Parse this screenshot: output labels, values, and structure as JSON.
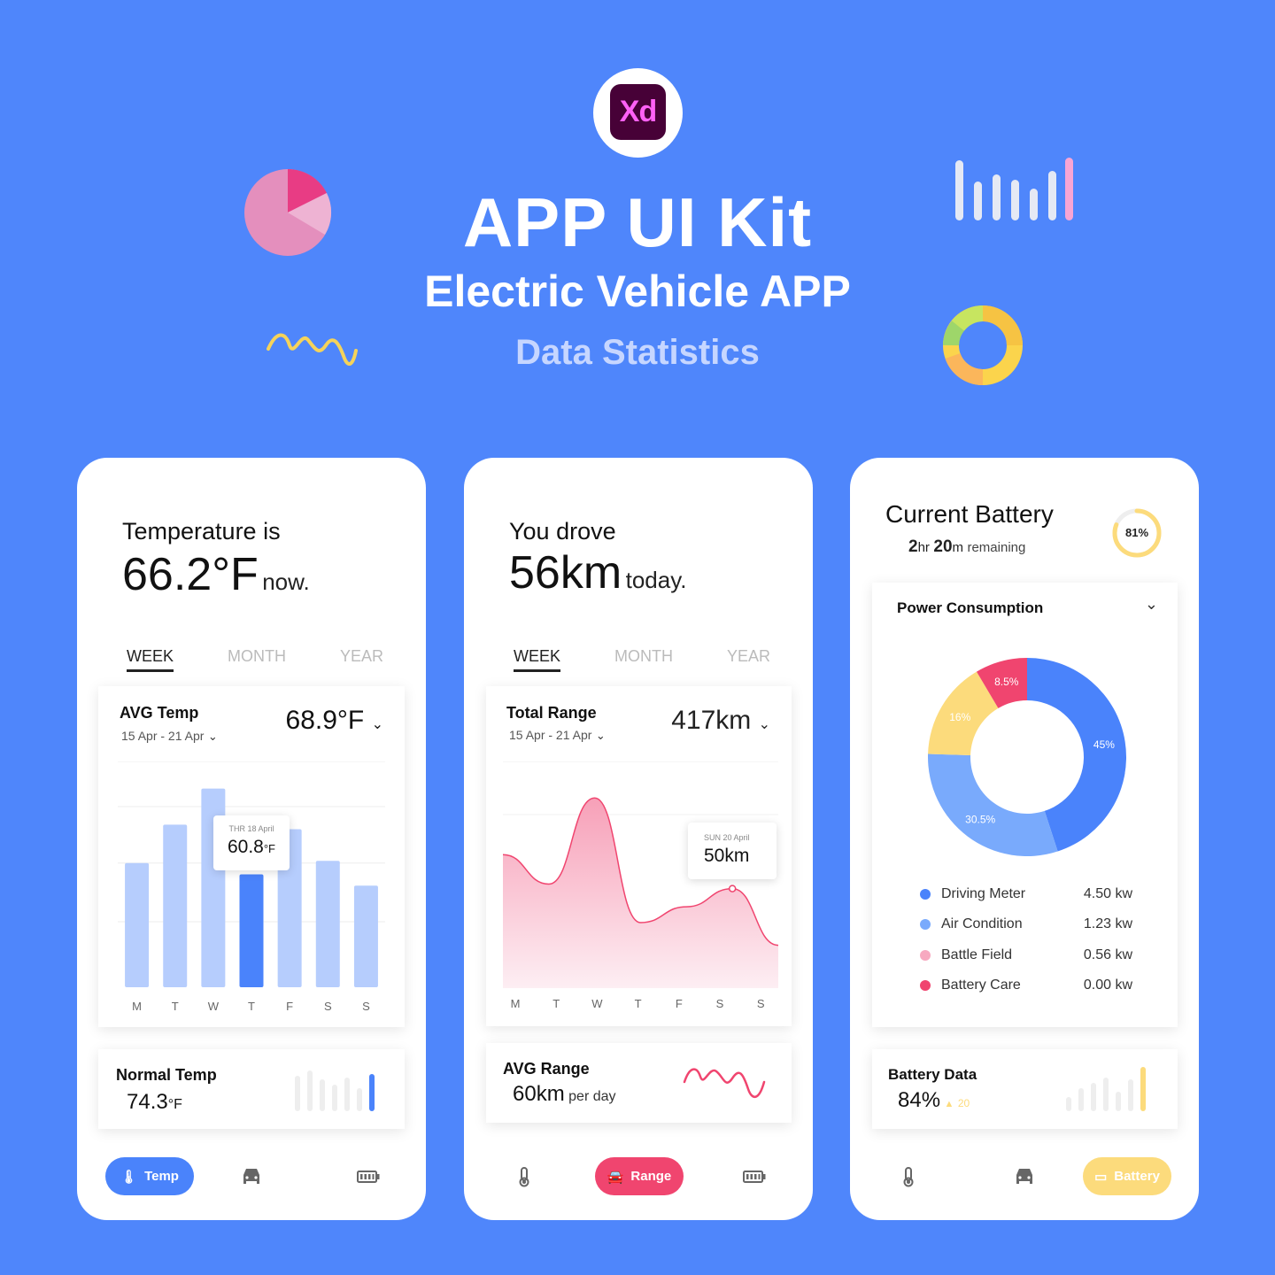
{
  "header": {
    "logo_text": "Xd",
    "title": "APP UI Kit",
    "subtitle": "Electric Vehicle APP",
    "tagline": "Data Statistics"
  },
  "colors": {
    "background": "#4f86fb",
    "blue": "#4a83fb",
    "light_blue": "#b6cdfd",
    "pink": "#f0456f",
    "yellow": "#fcdb7c"
  },
  "temp_screen": {
    "intro": "Temperature is",
    "value": "66.2°F",
    "suffix": "now.",
    "tabs": [
      "WEEK",
      "MONTH",
      "YEAR"
    ],
    "card": {
      "label": "AVG Temp",
      "range": "15 Apr - 21 Apr",
      "value": "68.9°F"
    },
    "tooltip": {
      "date": "THR 18 April",
      "value": "60.8",
      "unit": "°F"
    },
    "chart_data": {
      "type": "bar",
      "categories": [
        "M",
        "T",
        "W",
        "T",
        "F",
        "S",
        "S"
      ],
      "values": [
        55,
        72,
        88,
        50,
        70,
        56,
        45
      ],
      "highlight_index": 3,
      "ylim": [
        0,
        100
      ]
    },
    "normal": {
      "label": "Normal Temp",
      "value": "74.3",
      "unit": "°F"
    },
    "nav": {
      "active_label": "Temp"
    }
  },
  "range_screen": {
    "intro": "You drove",
    "value": "56km",
    "suffix": "today.",
    "tabs": [
      "WEEK",
      "MONTH",
      "YEAR"
    ],
    "card": {
      "label": "Total Range",
      "range": "15 Apr - 21 Apr",
      "value": "417km"
    },
    "tooltip": {
      "date": "SUN 20 April",
      "value": "50km"
    },
    "chart_data": {
      "type": "area",
      "categories": [
        "M",
        "T",
        "W",
        "T",
        "F",
        "S",
        "S"
      ],
      "values": [
        55,
        42,
        80,
        25,
        32,
        40,
        15
      ],
      "ylim": [
        0,
        100
      ]
    },
    "avg": {
      "label": "AVG Range",
      "value": "60km",
      "unit": "per day"
    },
    "nav": {
      "active_label": "Range"
    }
  },
  "battery_screen": {
    "title": "Current Battery",
    "hours": "2",
    "hours_unit": "hr",
    "minutes": "20",
    "minutes_unit": "m",
    "remaining": "remaining",
    "level": "81%",
    "level_value": 81,
    "section_title": "Power Consumption",
    "chart_data": {
      "type": "pie",
      "slices": [
        {
          "label": "45%",
          "value": 45,
          "color": "#4a83fb"
        },
        {
          "label": "30.5%",
          "value": 30.5,
          "color": "#79aafc"
        },
        {
          "label": "16%",
          "value": 16,
          "color": "#fcdb7c"
        },
        {
          "label": "8.5%",
          "value": 8.5,
          "color": "#f0456f"
        }
      ]
    },
    "legend": [
      {
        "name": "Driving Meter",
        "value": "4.50 kw",
        "color": "#4a83fb"
      },
      {
        "name": "Air Condition",
        "value": "1.23 kw",
        "color": "#79aafc"
      },
      {
        "name": "Battle Field",
        "value": "0.56 kw",
        "color": "#f7a9c0"
      },
      {
        "name": "Battery Care",
        "value": "0.00 kw",
        "color": "#f0456f"
      }
    ],
    "data_card": {
      "label": "Battery Data",
      "value": "84%",
      "delta": "20"
    },
    "nav": {
      "active_label": "Battery"
    }
  }
}
